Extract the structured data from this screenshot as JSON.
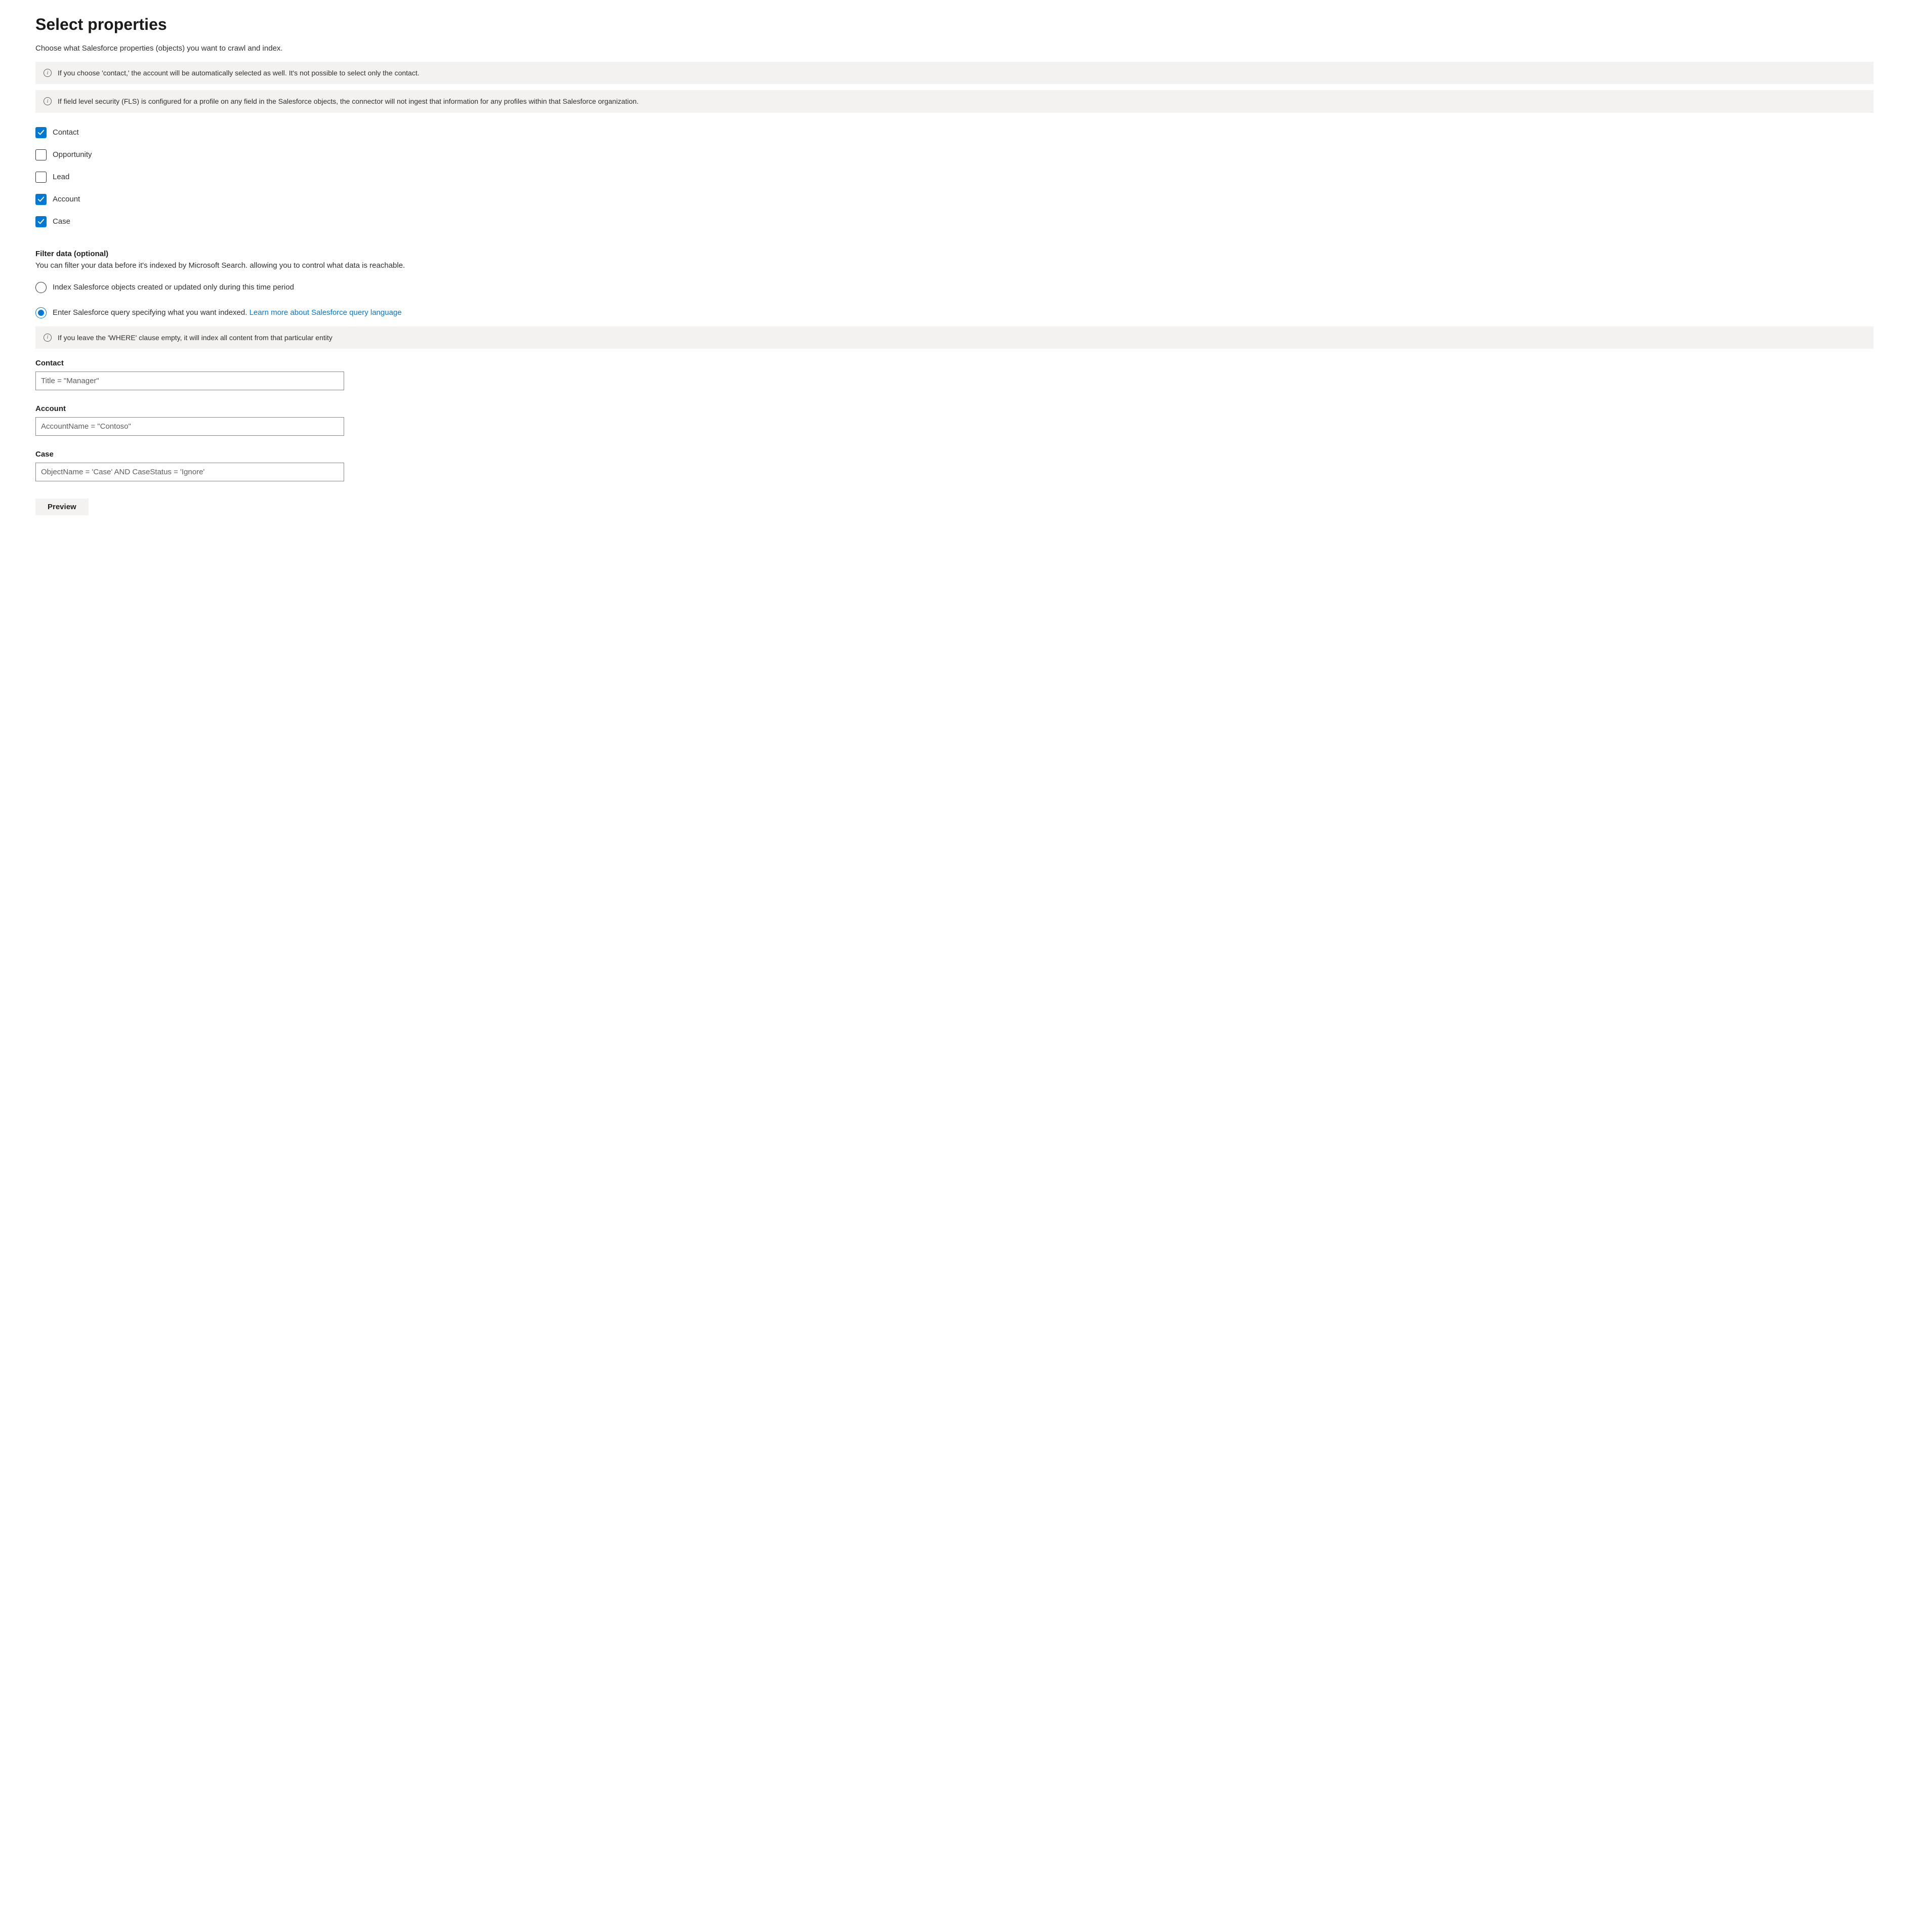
{
  "title": "Select properties",
  "subtitle": "Choose what Salesforce properties (objects) you want to crawl and index.",
  "banners": {
    "contact_note": "If you choose 'contact,' the account will be automatically selected as well. It's not possible to select only the contact.",
    "fls_note": "If field level security (FLS) is configured for a profile on any field in the Salesforce objects, the connector will not ingest that information for any profiles within that Salesforce organization."
  },
  "properties": [
    {
      "label": "Contact",
      "checked": true
    },
    {
      "label": "Opportunity",
      "checked": false
    },
    {
      "label": "Lead",
      "checked": false
    },
    {
      "label": "Account",
      "checked": true
    },
    {
      "label": "Case",
      "checked": true
    }
  ],
  "filter": {
    "heading": "Filter data (optional)",
    "description": "You can filter your data before it's indexed by Microsoft Search. allowing you to control what data is reachable.",
    "options": [
      {
        "label": "Index Salesforce objects created or updated only during this time period",
        "selected": false
      },
      {
        "label_prefix": "Enter Salesforce query specifying what you want indexed. ",
        "link_text": "Learn more about Salesforce query language",
        "selected": true
      }
    ],
    "where_note": "If you leave the 'WHERE' clause empty, it will index all content from that particular entity"
  },
  "queries": [
    {
      "label": "Contact",
      "value": "Title = \"Manager\""
    },
    {
      "label": "Account",
      "value": "AccountName = \"Contoso\""
    },
    {
      "label": "Case",
      "value": "ObjectName = 'Case' AND CaseStatus = 'Ignore'"
    }
  ],
  "preview_button": "Preview"
}
